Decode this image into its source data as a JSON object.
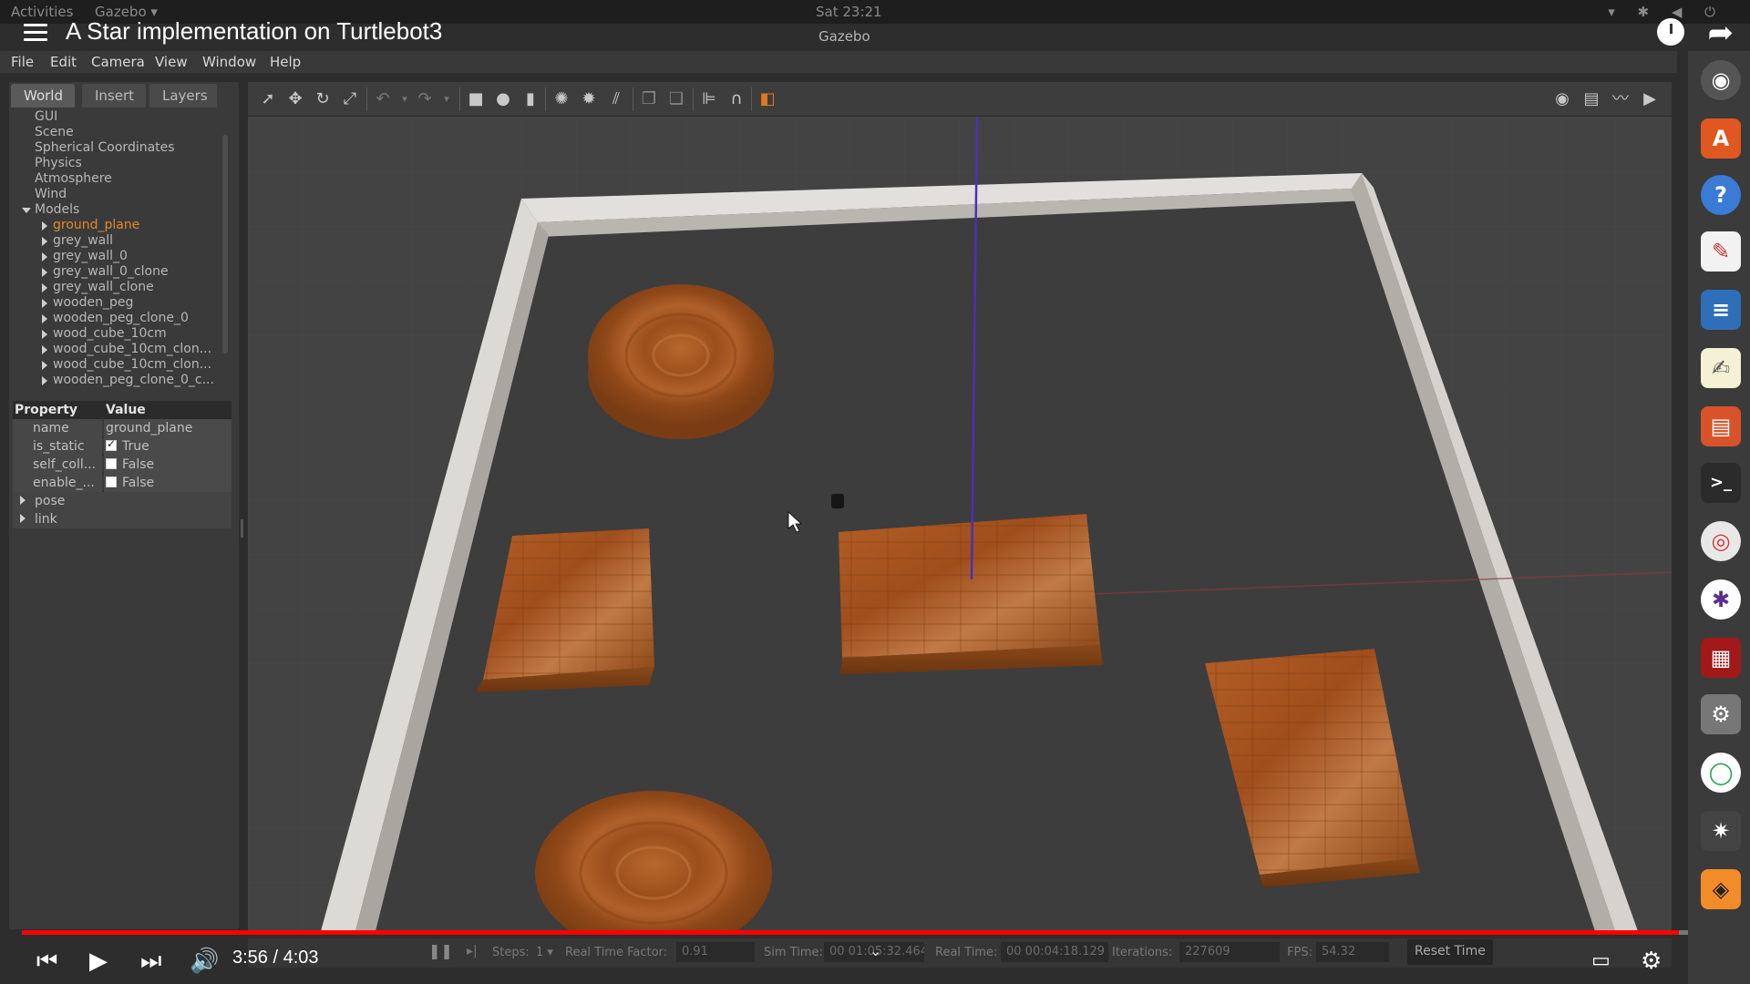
{
  "os_topbar": {
    "activities": "Activities",
    "app": "Gazebo ▾",
    "clock": "Sat 23:21"
  },
  "video": {
    "title": "A Star implementation on Turtlebot3",
    "time": "3:56 / 4:03",
    "progress_fraction": 0.971
  },
  "gazebo": {
    "window_title": "Gazebo",
    "menu": [
      "File",
      "Edit",
      "Camera",
      "View",
      "Window",
      "Help"
    ],
    "tabs": [
      "World",
      "Insert",
      "Layers"
    ],
    "tree_top": [
      "GUI",
      "Scene",
      "Spherical Coordinates",
      "Physics",
      "Atmosphere",
      "Wind",
      "Models"
    ],
    "models": [
      "ground_plane",
      "grey_wall",
      "grey_wall_0",
      "grey_wall_0_clone",
      "grey_wall_clone",
      "wooden_peg",
      "wooden_peg_clone_0",
      "wood_cube_10cm",
      "wood_cube_10cm_clon...",
      "wood_cube_10cm_clon...",
      "wooden_peg_clone_0_c..."
    ],
    "properties": {
      "header": {
        "key": "Property",
        "value": "Value"
      },
      "rows": [
        {
          "key": "name",
          "value": "ground_plane"
        },
        {
          "key": "is_static",
          "value": "True",
          "checked": true
        },
        {
          "key": "self_coll...",
          "value": "False",
          "checked": false
        },
        {
          "key": "enable_...",
          "value": "False",
          "checked": false
        }
      ],
      "sections": [
        "pose",
        "link"
      ]
    },
    "status": {
      "steps_label": "Steps:",
      "steps_value": "1 ▾",
      "rtf_label": "Real Time Factor:",
      "rtf_value": "0.91",
      "sim_time_label": "Sim Time:",
      "sim_time_value": "00 01:05:32.464",
      "real_time_label": "Real Time:",
      "real_time_value": "00 00:04:18.129",
      "iterations_label": "Iterations:",
      "iterations_value": "227609",
      "fps_label": "FPS:",
      "fps_value": "54.32",
      "reset_label": "Reset Time"
    }
  },
  "colors": {
    "progress": "#ff0000",
    "selected_model": "#e08a2a",
    "wood": "#a8541f",
    "wall": "#d9d7d2"
  },
  "icons": {
    "yt_menu": "hamburger-icon",
    "yt_share": "share-icon",
    "yt_watch_later": "clock-icon",
    "launcher": [
      "webcam-icon",
      "software-center-icon",
      "help-icon",
      "text-editor-icon",
      "writer-icon",
      "gedit-icon",
      "impress-icon",
      "terminal-icon",
      "chrome-icon",
      "slack-icon",
      "app-red-icon",
      "settings-icon",
      "refresh-app-icon",
      "network-icon",
      "gazebo-icon"
    ]
  }
}
